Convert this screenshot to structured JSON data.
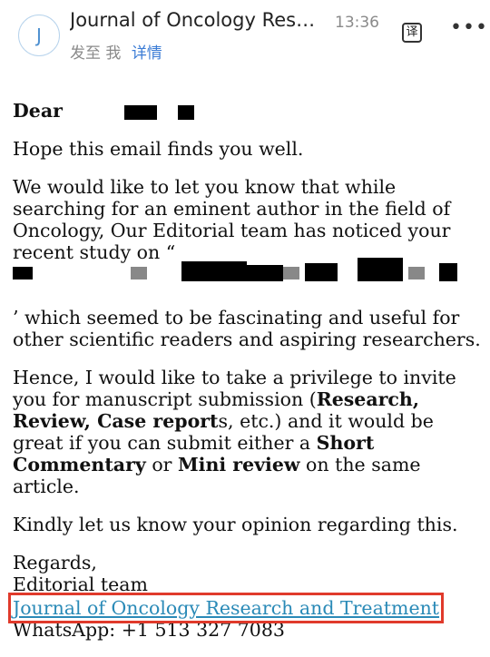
{
  "header": {
    "avatar_letter": "J",
    "sender": "Journal of Oncology Research and Treatment",
    "time": "13:36",
    "recipient_prefix": "发至 我",
    "details_label": "详情",
    "translate_icon_glyph": "译",
    "more_icon_glyph": "•••"
  },
  "email": {
    "greeting": "Dear",
    "line1": "Hope this email finds you well.",
    "para2": "We would like to let you know that while searching for an eminent author in the field of Oncology, Our Editorial team has noticed your recent study on “",
    "para2_tail": "’ which seemed to be fascinating and useful for other scientific readers and aspiring researchers.",
    "para3_a": "Hence, I would like to take a privilege to invite you for manuscript submission (",
    "para3_b1": "Research, Review, Case report",
    "para3_c": "s, etc.) and it would be great if you can submit either a ",
    "para3_b2": "Short Commentary",
    "para3_d": " or ",
    "para3_b3": "Mini review",
    "para3_e": " on the same article.",
    "para4": "Kindly let us know your opinion regarding this.",
    "regards": "Regards,",
    "team": "Editorial team",
    "journal_link": "Journal of Oncology Research and Treatment",
    "whatsapp": "WhatsApp: +1 513 327 7083"
  },
  "colors": {
    "link": "#2a8ab7",
    "highlight_box": "#e03a2b",
    "details": "#3a7bd5"
  }
}
